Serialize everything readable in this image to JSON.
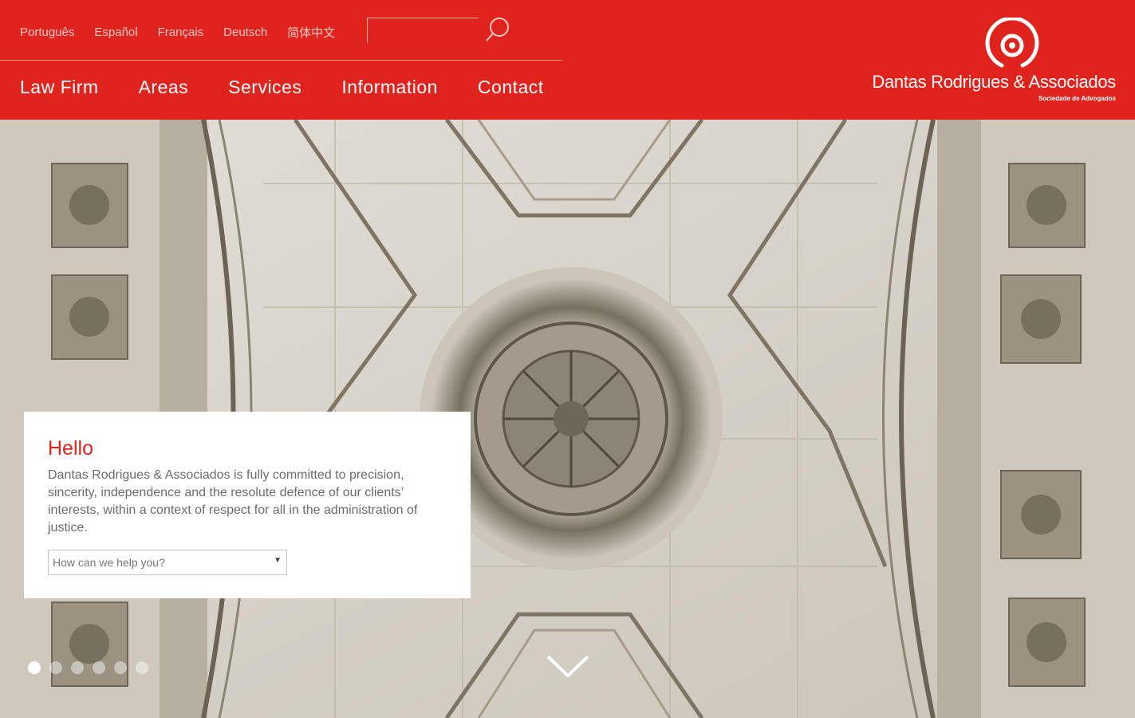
{
  "languages": [
    "Português",
    "Español",
    "Français",
    "Deutsch",
    "简体中文"
  ],
  "search": {
    "placeholder": "",
    "value": ""
  },
  "nav": [
    "Law Firm",
    "Areas",
    "Services",
    "Information",
    "Contact"
  ],
  "logo": {
    "name": "Dantas Rodrigues & Associados",
    "tagline": "Sociedade de Advogados"
  },
  "hello": {
    "title": "Hello",
    "text": "Dantas Rodrigues & Associados is fully committed to precision, sincerity, independence and the resolute defence of our clients’ interests, within a context of respect for all in the administration of justice.",
    "select_value": "How can we help you?"
  },
  "slider": {
    "count": 6,
    "active": 1
  },
  "colors": {
    "brand": "#e0231c",
    "white": "#ffffff"
  },
  "icons": {
    "search": "magnifier-icon",
    "scroll": "chevron-down-icon"
  }
}
